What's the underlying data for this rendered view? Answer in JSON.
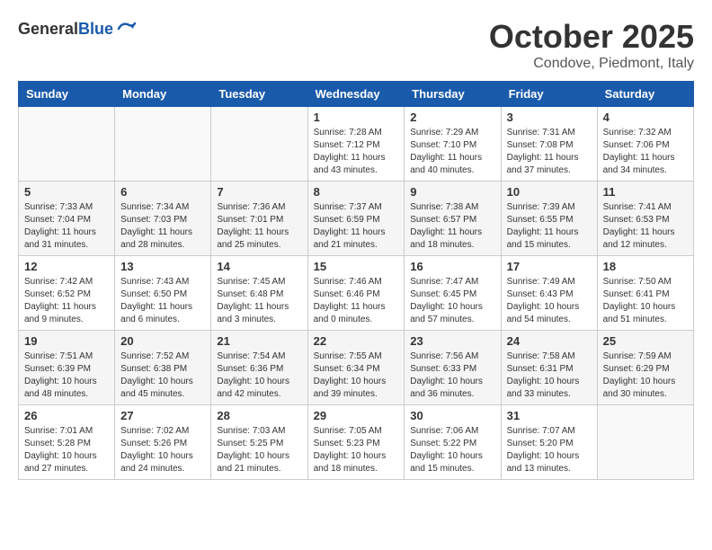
{
  "logo": {
    "general": "General",
    "blue": "Blue"
  },
  "title": "October 2025",
  "location": "Condove, Piedmont, Italy",
  "weekdays": [
    "Sunday",
    "Monday",
    "Tuesday",
    "Wednesday",
    "Thursday",
    "Friday",
    "Saturday"
  ],
  "weeks": [
    [
      {
        "day": "",
        "info": ""
      },
      {
        "day": "",
        "info": ""
      },
      {
        "day": "",
        "info": ""
      },
      {
        "day": "1",
        "info": "Sunrise: 7:28 AM\nSunset: 7:12 PM\nDaylight: 11 hours\nand 43 minutes."
      },
      {
        "day": "2",
        "info": "Sunrise: 7:29 AM\nSunset: 7:10 PM\nDaylight: 11 hours\nand 40 minutes."
      },
      {
        "day": "3",
        "info": "Sunrise: 7:31 AM\nSunset: 7:08 PM\nDaylight: 11 hours\nand 37 minutes."
      },
      {
        "day": "4",
        "info": "Sunrise: 7:32 AM\nSunset: 7:06 PM\nDaylight: 11 hours\nand 34 minutes."
      }
    ],
    [
      {
        "day": "5",
        "info": "Sunrise: 7:33 AM\nSunset: 7:04 PM\nDaylight: 11 hours\nand 31 minutes."
      },
      {
        "day": "6",
        "info": "Sunrise: 7:34 AM\nSunset: 7:03 PM\nDaylight: 11 hours\nand 28 minutes."
      },
      {
        "day": "7",
        "info": "Sunrise: 7:36 AM\nSunset: 7:01 PM\nDaylight: 11 hours\nand 25 minutes."
      },
      {
        "day": "8",
        "info": "Sunrise: 7:37 AM\nSunset: 6:59 PM\nDaylight: 11 hours\nand 21 minutes."
      },
      {
        "day": "9",
        "info": "Sunrise: 7:38 AM\nSunset: 6:57 PM\nDaylight: 11 hours\nand 18 minutes."
      },
      {
        "day": "10",
        "info": "Sunrise: 7:39 AM\nSunset: 6:55 PM\nDaylight: 11 hours\nand 15 minutes."
      },
      {
        "day": "11",
        "info": "Sunrise: 7:41 AM\nSunset: 6:53 PM\nDaylight: 11 hours\nand 12 minutes."
      }
    ],
    [
      {
        "day": "12",
        "info": "Sunrise: 7:42 AM\nSunset: 6:52 PM\nDaylight: 11 hours\nand 9 minutes."
      },
      {
        "day": "13",
        "info": "Sunrise: 7:43 AM\nSunset: 6:50 PM\nDaylight: 11 hours\nand 6 minutes."
      },
      {
        "day": "14",
        "info": "Sunrise: 7:45 AM\nSunset: 6:48 PM\nDaylight: 11 hours\nand 3 minutes."
      },
      {
        "day": "15",
        "info": "Sunrise: 7:46 AM\nSunset: 6:46 PM\nDaylight: 11 hours\nand 0 minutes."
      },
      {
        "day": "16",
        "info": "Sunrise: 7:47 AM\nSunset: 6:45 PM\nDaylight: 10 hours\nand 57 minutes."
      },
      {
        "day": "17",
        "info": "Sunrise: 7:49 AM\nSunset: 6:43 PM\nDaylight: 10 hours\nand 54 minutes."
      },
      {
        "day": "18",
        "info": "Sunrise: 7:50 AM\nSunset: 6:41 PM\nDaylight: 10 hours\nand 51 minutes."
      }
    ],
    [
      {
        "day": "19",
        "info": "Sunrise: 7:51 AM\nSunset: 6:39 PM\nDaylight: 10 hours\nand 48 minutes."
      },
      {
        "day": "20",
        "info": "Sunrise: 7:52 AM\nSunset: 6:38 PM\nDaylight: 10 hours\nand 45 minutes."
      },
      {
        "day": "21",
        "info": "Sunrise: 7:54 AM\nSunset: 6:36 PM\nDaylight: 10 hours\nand 42 minutes."
      },
      {
        "day": "22",
        "info": "Sunrise: 7:55 AM\nSunset: 6:34 PM\nDaylight: 10 hours\nand 39 minutes."
      },
      {
        "day": "23",
        "info": "Sunrise: 7:56 AM\nSunset: 6:33 PM\nDaylight: 10 hours\nand 36 minutes."
      },
      {
        "day": "24",
        "info": "Sunrise: 7:58 AM\nSunset: 6:31 PM\nDaylight: 10 hours\nand 33 minutes."
      },
      {
        "day": "25",
        "info": "Sunrise: 7:59 AM\nSunset: 6:29 PM\nDaylight: 10 hours\nand 30 minutes."
      }
    ],
    [
      {
        "day": "26",
        "info": "Sunrise: 7:01 AM\nSunset: 5:28 PM\nDaylight: 10 hours\nand 27 minutes."
      },
      {
        "day": "27",
        "info": "Sunrise: 7:02 AM\nSunset: 5:26 PM\nDaylight: 10 hours\nand 24 minutes."
      },
      {
        "day": "28",
        "info": "Sunrise: 7:03 AM\nSunset: 5:25 PM\nDaylight: 10 hours\nand 21 minutes."
      },
      {
        "day": "29",
        "info": "Sunrise: 7:05 AM\nSunset: 5:23 PM\nDaylight: 10 hours\nand 18 minutes."
      },
      {
        "day": "30",
        "info": "Sunrise: 7:06 AM\nSunset: 5:22 PM\nDaylight: 10 hours\nand 15 minutes."
      },
      {
        "day": "31",
        "info": "Sunrise: 7:07 AM\nSunset: 5:20 PM\nDaylight: 10 hours\nand 13 minutes."
      },
      {
        "day": "",
        "info": ""
      }
    ]
  ]
}
